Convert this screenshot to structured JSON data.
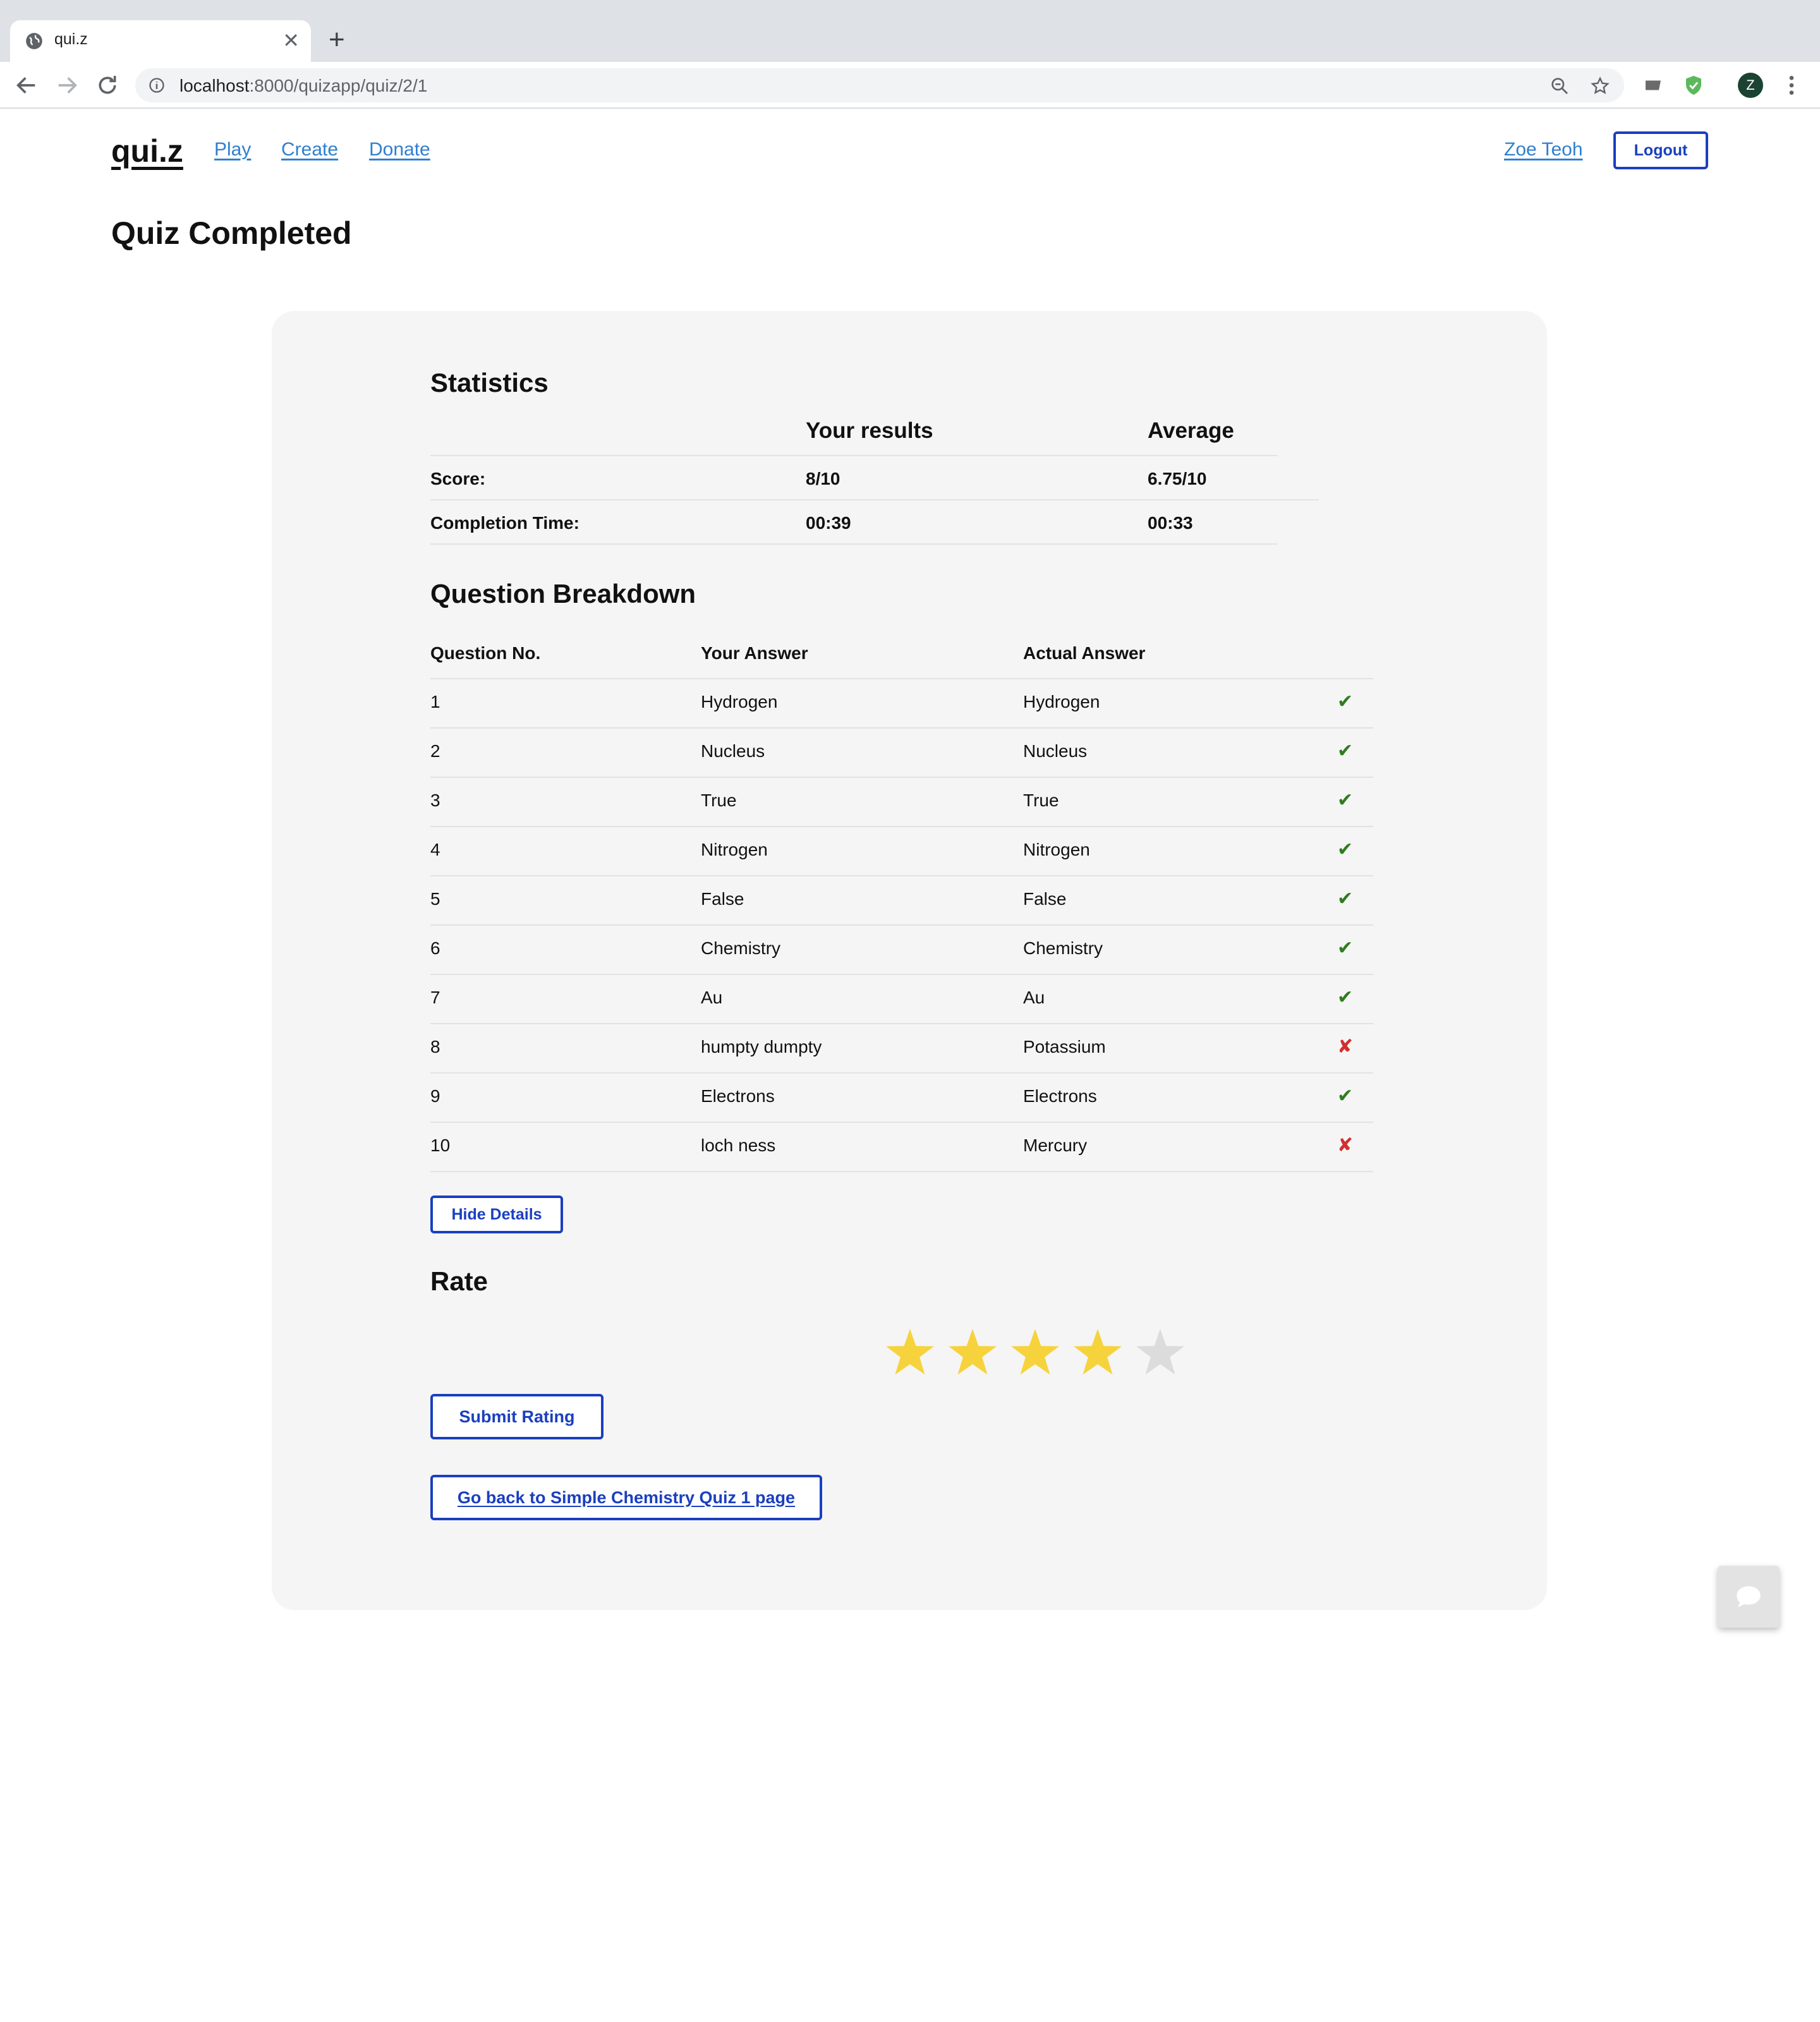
{
  "browser": {
    "tab_title": "qui.z",
    "url_host": "localhost",
    "url_path": ":8000/quizapp/quiz/2/1",
    "profile_initial": "Z"
  },
  "site": {
    "logo": "qui.z",
    "nav": [
      "Play",
      "Create",
      "Donate"
    ],
    "user_name": "Zoe Teoh",
    "logout_label": "Logout"
  },
  "page_title": "Quiz Completed",
  "statistics": {
    "title": "Statistics",
    "col_your": "Your results",
    "col_avg": "Average",
    "rows": [
      {
        "label": "Score:",
        "yours": "8/10",
        "avg": "6.75/10"
      },
      {
        "label": "Completion Time:",
        "yours": "00:39",
        "avg": "00:33"
      }
    ]
  },
  "breakdown": {
    "title": "Question Breakdown",
    "headers": [
      "Question No.",
      "Your Answer",
      "Actual Answer"
    ],
    "rows": [
      {
        "no": "1",
        "yours": "Hydrogen",
        "actual": "Hydrogen",
        "mark": "✔"
      },
      {
        "no": "2",
        "yours": "Nucleus",
        "actual": "Nucleus",
        "mark": "✔"
      },
      {
        "no": "3",
        "yours": "True",
        "actual": "True",
        "mark": "✔"
      },
      {
        "no": "4",
        "yours": "Nitrogen",
        "actual": "Nitrogen",
        "mark": "✔"
      },
      {
        "no": "5",
        "yours": "False",
        "actual": "False",
        "mark": "✔"
      },
      {
        "no": "6",
        "yours": "Chemistry",
        "actual": "Chemistry",
        "mark": "✔"
      },
      {
        "no": "7",
        "yours": "Au",
        "actual": "Au",
        "mark": "✔"
      },
      {
        "no": "8",
        "yours": "humpty dumpty",
        "actual": "Potassium",
        "mark": "✘"
      },
      {
        "no": "9",
        "yours": "Electrons",
        "actual": "Electrons",
        "mark": "✔"
      },
      {
        "no": "10",
        "yours": "loch ness",
        "actual": "Mercury",
        "mark": "✘"
      }
    ],
    "hide_label": "Hide Details"
  },
  "rate": {
    "title": "Rate",
    "rating": 4,
    "max": 5,
    "star_color": "#f6d33d",
    "empty_color": "#dcdcdc",
    "submit_label": "Submit Rating"
  },
  "back_label": "Go back to Simple Chemistry Quiz 1 page",
  "colors": {
    "accent": "#1a3fbf",
    "link": "#2f7fd0",
    "correct": "#2e7d1f",
    "wrong": "#d32f2f"
  }
}
